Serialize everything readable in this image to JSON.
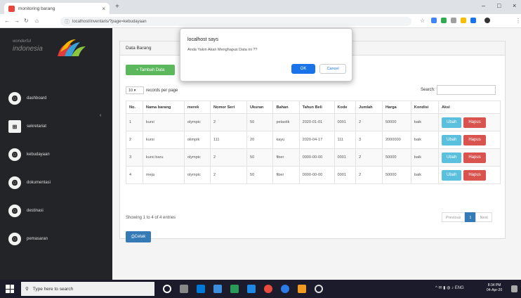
{
  "browser": {
    "tab_title": "monitoring barang",
    "tab_close": "×",
    "new_tab": "+",
    "url": "localhost/inventaris/?page=kebudayaan",
    "window_controls": [
      "–",
      "□",
      "×"
    ]
  },
  "sidebar": {
    "logo_line1": "wonderful",
    "logo_line2": "indonesia",
    "toggle": "‹",
    "items": [
      {
        "label": "dashboard"
      },
      {
        "label": "sekretariat"
      },
      {
        "label": "kebudayaan"
      },
      {
        "label": "dokumentasi"
      },
      {
        "label": "destinasi"
      },
      {
        "label": "pemasaran"
      }
    ]
  },
  "panel": {
    "title": "Data Barang",
    "add_button": "+ Tambah Data",
    "records_value": "10",
    "records_label": "records per page",
    "search_label": "Search:",
    "columns": [
      "No.",
      "Nama barang",
      "merek",
      "Nomor Seri",
      "Ukuran",
      "Bahan",
      "Tahun Beli",
      "Kode",
      "Jumlah",
      "Harga",
      "Kondisi",
      "Aksi"
    ],
    "rows": [
      [
        "1",
        "kursi",
        "olympic",
        "2",
        "50",
        "pelastik",
        "2020-01-01",
        "0001",
        "2",
        "50000",
        "baik"
      ],
      [
        "2",
        "kursi",
        "olimpik",
        "111",
        "20",
        "kayu",
        "2020-04-17",
        "111",
        "3",
        "2000000",
        "baik"
      ],
      [
        "3",
        "kursi baru",
        "olympic",
        "2",
        "50",
        "fiber",
        "0000-00-00",
        "0001",
        "2",
        "50000",
        "baik"
      ],
      [
        "4",
        "meja",
        "olympic",
        "2",
        "50",
        "fiber",
        "0000-00-00",
        "0001",
        "2",
        "50000",
        "baik"
      ]
    ],
    "edit_label": "Ubah",
    "delete_label": "Hapus",
    "showing": "Showing 1 to 4 of 4 entries",
    "pager": {
      "prev": "Previous",
      "page": "1",
      "next": "Next"
    },
    "print_button": "⎙Cetak"
  },
  "dialog": {
    "title": "localhost says",
    "message": "Anda Yakin Akan Menghapus Data ini ??",
    "ok": "OK",
    "cancel": "Cancel"
  },
  "taskbar": {
    "search_placeholder": "Type here to search",
    "time": "8:34 PM",
    "date": "04-Apr-20"
  }
}
